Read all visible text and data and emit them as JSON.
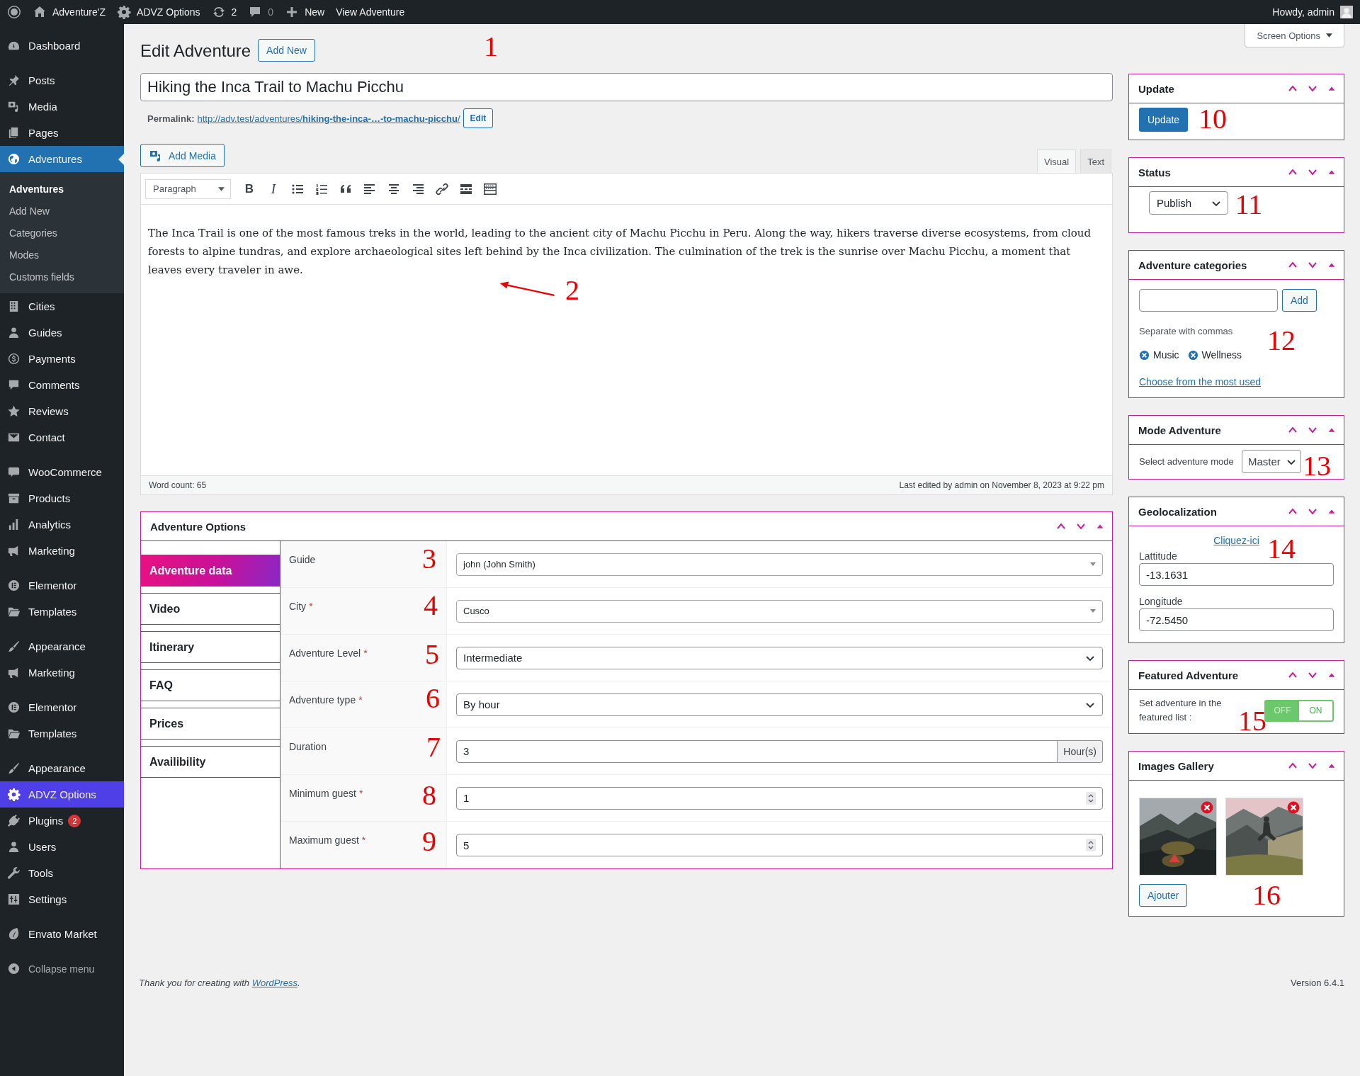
{
  "admin_bar": {
    "site_name": "Adventure'Z",
    "options_label": "ADVZ Options",
    "updates_count": "2",
    "comments_count": "0",
    "new_label": "New",
    "view_label": "View Adventure",
    "greeting": "Howdy, admin"
  },
  "sidebar": {
    "groups": [
      {
        "items": [
          {
            "label": "Dashboard",
            "selected": false,
            "hovered": false
          }
        ]
      },
      {
        "items": [
          {
            "label": "Posts",
            "selected": false,
            "hovered": false
          },
          {
            "label": "Media",
            "selected": false,
            "hovered": false
          },
          {
            "label": "Pages",
            "selected": false,
            "hovered": false
          },
          {
            "label": "Adventures",
            "selected": true,
            "hovered": false,
            "children": [
              {
                "label": "Adventures",
                "selected": true
              },
              {
                "label": "Add New",
                "selected": false
              },
              {
                "label": "Categories",
                "selected": false
              },
              {
                "label": "Modes",
                "selected": false
              },
              {
                "label": "Customs fields",
                "selected": false
              }
            ]
          },
          {
            "label": "Cities",
            "selected": false,
            "hovered": false
          },
          {
            "label": "Guides",
            "selected": false,
            "hovered": false
          },
          {
            "label": "Payments",
            "selected": false,
            "hovered": false
          },
          {
            "label": "Comments",
            "selected": false,
            "hovered": false
          },
          {
            "label": "Reviews",
            "selected": false,
            "hovered": false
          },
          {
            "label": "Contact",
            "selected": false,
            "hovered": false
          }
        ]
      },
      {
        "items": [
          {
            "label": "WooCommerce",
            "selected": false,
            "hovered": false
          },
          {
            "label": "Products",
            "selected": false,
            "hovered": false
          },
          {
            "label": "Analytics",
            "selected": false,
            "hovered": false
          },
          {
            "label": "Marketing",
            "selected": false,
            "hovered": false
          }
        ]
      },
      {
        "items": [
          {
            "label": "Elementor",
            "selected": false,
            "hovered": false
          },
          {
            "label": "Templates",
            "selected": false,
            "hovered": false
          }
        ]
      },
      {
        "items": [
          {
            "label": "Appearance",
            "selected": false,
            "hovered": false
          },
          {
            "label": "Marketing",
            "selected": false,
            "hovered": false
          }
        ]
      },
      {
        "items": [
          {
            "label": "Elementor",
            "selected": false,
            "hovered": false
          },
          {
            "label": "Templates",
            "selected": false,
            "hovered": false
          }
        ]
      },
      {
        "items": [
          {
            "label": "Appearance",
            "selected": false,
            "hovered": false
          },
          {
            "label": "ADVZ Options",
            "selected": false,
            "hovered": true
          },
          {
            "label": "Plugins",
            "selected": false,
            "hovered": false,
            "badge": "2"
          },
          {
            "label": "Users",
            "selected": false,
            "hovered": false
          },
          {
            "label": "Tools",
            "selected": false,
            "hovered": false
          },
          {
            "label": "Settings",
            "selected": false,
            "hovered": false
          }
        ]
      },
      {
        "items": [
          {
            "label": "Envato Market",
            "selected": false,
            "hovered": false
          }
        ]
      }
    ],
    "collapse_label": "Collapse menu"
  },
  "screen_options": "Screen Options",
  "page_title": "Edit Adventure",
  "add_new": "Add New",
  "post_title": "Hiking the Inca Trail to Machu Picchu",
  "permalink": {
    "label": "Permalink:",
    "url": "http://adv.test/adventures/**hiking-the-inca-…-to-machu-picchu**/",
    "edit": "Edit"
  },
  "editor": {
    "add_media": "Add Media",
    "tabs": [
      {
        "label": "Visual",
        "selected": true
      },
      {
        "label": "Text",
        "selected": false
      }
    ],
    "format": "Paragraph",
    "bold": "B",
    "italic": "I",
    "content": "The Inca Trail is one of the most famous treks in the world, leading to the ancient city of Machu Picchu in Peru. Along the way, hikers traverse diverse ecosystems, from cloud forests to alpine tundras, and explore archaeological sites left behind by the Inca civilization. The culmination of the trek is the sunrise over Machu Picchu, a moment that leaves every traveler in awe.",
    "word_count": "Word count: 65",
    "last_edited": "Last edited by admin on November 8, 2023 at 9:22 pm"
  },
  "adventure_options": {
    "title": "Adventure Options",
    "tabs": [
      {
        "label": "Adventure data",
        "selected": true
      },
      {
        "label": "Video",
        "selected": false
      },
      {
        "label": "Itinerary",
        "selected": false
      },
      {
        "label": "FAQ",
        "selected": false
      },
      {
        "label": "Prices",
        "selected": false
      },
      {
        "label": "Availibility",
        "selected": false
      }
    ],
    "fields": [
      {
        "kind": "select",
        "label": "Guide",
        "value": "john (John Smith)"
      },
      {
        "kind": "select",
        "label": "City",
        "required_mark": "*",
        "value": "Cusco"
      },
      {
        "kind": "dropdown",
        "label": "Adventure Level",
        "required_mark": "*",
        "value": "Intermediate"
      },
      {
        "kind": "dropdown",
        "label": "Adventure type",
        "required_mark": "*",
        "value": "By hour"
      },
      {
        "kind": "unit",
        "label": "Duration",
        "value": "3",
        "unit": "Hour(s)"
      },
      {
        "kind": "number",
        "label": "Minimum guest",
        "required_mark": "*",
        "value": "1"
      },
      {
        "kind": "number",
        "label": "Maximum guest",
        "required_mark": "*",
        "value": "5"
      }
    ]
  },
  "update_box": {
    "title": "Update",
    "button": "Update"
  },
  "status_box": {
    "title": "Status",
    "value": "Publish"
  },
  "categories_box": {
    "title": "Adventure categories",
    "add": "Add",
    "hint": "Separate with commas",
    "tags": [
      "Music",
      "Wellness"
    ],
    "link": "Choose from the most used"
  },
  "mode_box": {
    "title": "Mode Adventure",
    "label": "Select adventure mode",
    "value": "Master"
  },
  "geo_box": {
    "title": "Geolocalization",
    "link": "Cliquez-ici",
    "fields": [
      {
        "label": "Lattitude",
        "value": "-13.1631"
      },
      {
        "label": "Longitude",
        "value": "-72.5450"
      }
    ]
  },
  "featured_box": {
    "title": "Featured Adventure",
    "label": "Set adventure in the featured list :",
    "switch": [
      {
        "label": "OFF",
        "selected": true
      },
      {
        "label": "ON",
        "selected": false
      }
    ]
  },
  "gallery_box": {
    "title": "Images Gallery",
    "button": "Ajouter"
  },
  "footer": {
    "credit": "Thank you for creating with",
    "credit_link": "WordPress",
    "credit_end": ".",
    "version": "Version 6.4.1"
  },
  "annotations": [
    "1",
    "2",
    "3",
    "4",
    "5",
    "6",
    "7",
    "8",
    "9",
    "10",
    "11",
    "12",
    "13",
    "14",
    "15",
    "16"
  ]
}
